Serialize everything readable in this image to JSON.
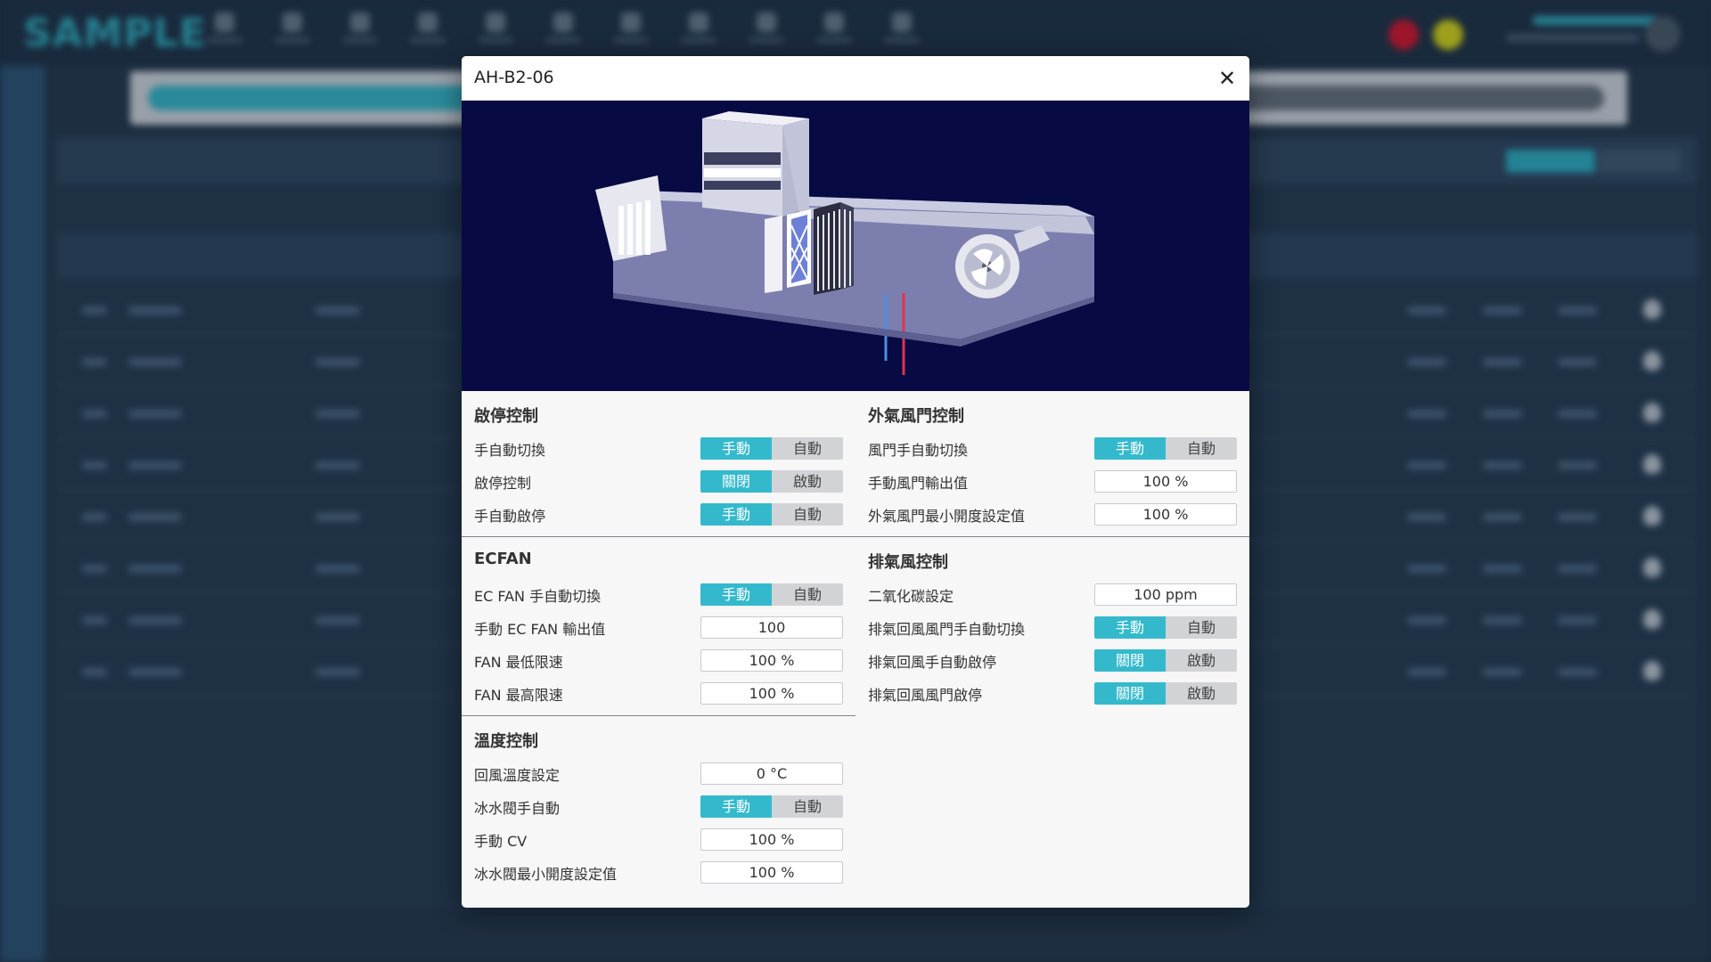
{
  "app": {
    "logo": "SAMPLE"
  },
  "modal": {
    "title": "AH-B2-06",
    "close_symbol": "✕"
  },
  "colors": {
    "accent": "#34b9cc",
    "diagram_bg": "#080a43",
    "alarm_red": "#e5102a",
    "alarm_yellow": "#e3e412"
  },
  "sections": {
    "start_stop": {
      "title": "啟停控制",
      "rows": [
        {
          "label": "手自動切換",
          "options": [
            "手動",
            "自動"
          ],
          "selected": 0
        },
        {
          "label": "啟停控制",
          "options": [
            "關閉",
            "啟動"
          ],
          "selected": 0
        },
        {
          "label": "手自動啟停",
          "options": [
            "手動",
            "自動"
          ],
          "selected": 0
        }
      ]
    },
    "ecfan": {
      "title": "ECFAN",
      "rows": [
        {
          "label": "EC FAN 手自動切換",
          "options": [
            "手動",
            "自動"
          ],
          "selected": 0
        },
        {
          "label": "手動 EC FAN 輸出值",
          "value": "100"
        },
        {
          "label": "FAN 最低限速",
          "value": "100 %"
        },
        {
          "label": "FAN 最高限速",
          "value": "100 %"
        }
      ]
    },
    "temperature": {
      "title": "溫度控制",
      "rows": [
        {
          "label": "回風溫度設定",
          "value": "0 °C"
        },
        {
          "label": "冰水閥手自動",
          "options": [
            "手動",
            "自動"
          ],
          "selected": 0
        },
        {
          "label": "手動 CV",
          "value": "100 %"
        },
        {
          "label": "冰水閥最小開度設定值",
          "value": "100 %"
        }
      ]
    },
    "outdoor_damper": {
      "title": "外氣風門控制",
      "rows": [
        {
          "label": "風門手自動切換",
          "options": [
            "手動",
            "自動"
          ],
          "selected": 0
        },
        {
          "label": "手動風門輸出值",
          "value": "100 %"
        },
        {
          "label": "外氣風門最小開度設定值",
          "value": "100 %"
        }
      ]
    },
    "exhaust": {
      "title": "排氣風控制",
      "rows": [
        {
          "label": "二氧化碳設定",
          "value": "100 ppm"
        },
        {
          "label": "排氣回風風門手自動切換",
          "options": [
            "手動",
            "自動"
          ],
          "selected": 0
        },
        {
          "label": "排氣回風手自動啟停",
          "options": [
            "關閉",
            "啟動"
          ],
          "selected": 0
        },
        {
          "label": "排氣回風風門啟停",
          "options": [
            "關閉",
            "啟動"
          ],
          "selected": 0
        }
      ]
    }
  }
}
